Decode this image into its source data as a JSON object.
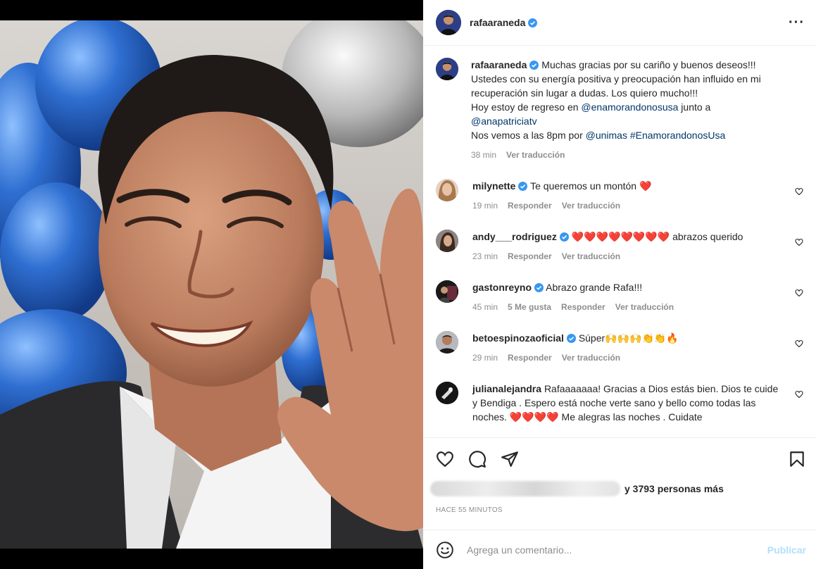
{
  "post": {
    "username": "rafaaraneda",
    "caption": {
      "username": "rafaaraneda",
      "line1": "Muchas gracias por su cariño y buenos deseos!!! Ustedes con su energía positiva y preocupación han influido en mi recuperación sin lugar a dudas. Los quiero mucho!!!",
      "line2_pre": "Hoy estoy de regreso en ",
      "mention1": "@enamorandonosusa",
      "line2_mid": " junto a ",
      "mention2": "@anapatriciatv",
      "line3_pre": "Nos vemos a las 8pm por ",
      "mention3": "@unimas",
      "hashtag": "#EnamorandonosUsa",
      "time": "38 min",
      "translate": "Ver traducción"
    }
  },
  "comments": [
    {
      "username": "milynette",
      "text": "Te queremos un montón",
      "hearts": "❤️",
      "time": "19 min",
      "reply": "Responder",
      "translate": "Ver traducción",
      "likes": ""
    },
    {
      "username": "andy___rodriguez",
      "text": "abrazos querido",
      "hearts": "❤️❤️❤️❤️❤️❤️❤️❤️",
      "time": "23 min",
      "reply": "Responder",
      "translate": "Ver traducción",
      "likes": ""
    },
    {
      "username": "gastonreyno",
      "text": "Abrazo grande Rafa!!!",
      "hearts": "",
      "time": "45 min",
      "reply": "Responder",
      "translate": "Ver traducción",
      "likes": "5 Me gusta"
    },
    {
      "username": "betoespinozaoficial",
      "text": "Súper🙌🙌🙌👏👏🔥",
      "hearts": "",
      "time": "29 min",
      "reply": "Responder",
      "translate": "Ver traducción",
      "likes": ""
    },
    {
      "username": "julianalejandra",
      "text": "Rafaaaaaaa! Gracias a Dios estás bien. Dios te cuide y Bendiga . Espero está noche verte sano y bello como todas las noches. ❤️❤️❤️❤️ Me alegras las noches . Cuidate",
      "hearts": "",
      "time": "",
      "reply": "",
      "translate": "",
      "likes": ""
    }
  ],
  "likes": {
    "suffix": "y 3793 personas más"
  },
  "posted_ago": "HACE 55 MINUTOS",
  "add_comment": {
    "placeholder": "Agrega un comentario...",
    "publish": "Publicar"
  },
  "icons": [
    "heart-icon",
    "comment-icon",
    "share-icon",
    "bookmark-icon",
    "emoji-icon",
    "verified-icon",
    "more-icon"
  ],
  "colors": {
    "link": "#00376b",
    "verified": "#3897f0",
    "publish_disabled": "#b2dffc",
    "meta": "#8e8e8e"
  }
}
